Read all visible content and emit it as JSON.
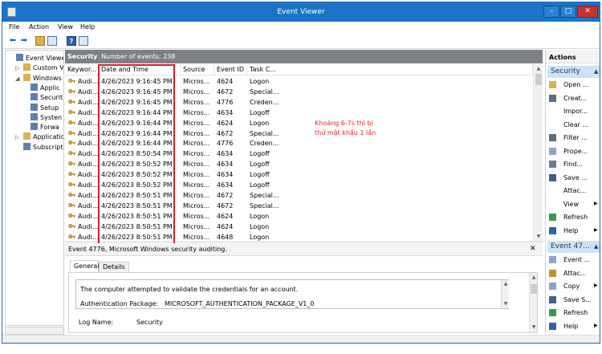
{
  "window": {
    "title": "Event Viewer",
    "minimize": "–",
    "maximize": "□",
    "close": "✕"
  },
  "menu": [
    "File",
    "Action",
    "View",
    "Help"
  ],
  "toolbar": {
    "back": "⬅",
    "forward": "➡",
    "help": "?"
  },
  "tree": [
    {
      "label": "Event Viewer (",
      "icon": "event-viewer-icon",
      "level": 0,
      "expander": ""
    },
    {
      "label": "Custom V",
      "icon": "folder-icon",
      "level": 1,
      "expander": "▷"
    },
    {
      "label": "Windows",
      "icon": "folder-icon",
      "level": 1,
      "expander": "◢"
    },
    {
      "label": "Applic",
      "icon": "log-icon",
      "level": 2,
      "expander": ""
    },
    {
      "label": "Securit",
      "icon": "log-icon",
      "level": 2,
      "expander": ""
    },
    {
      "label": "Setup",
      "icon": "log-icon",
      "level": 2,
      "expander": ""
    },
    {
      "label": "Systen",
      "icon": "log-icon",
      "level": 2,
      "expander": ""
    },
    {
      "label": "Forwa",
      "icon": "log-icon",
      "level": 2,
      "expander": ""
    },
    {
      "label": "Applicatio",
      "icon": "folder-icon",
      "level": 1,
      "expander": "▷"
    },
    {
      "label": "Subscripti",
      "icon": "subscription-icon",
      "level": 1,
      "expander": ""
    }
  ],
  "center": {
    "title": "Security",
    "count": "Number of events: 238"
  },
  "columns": [
    "Keywor...",
    "Date and Time",
    "Source",
    "Event ID",
    "Task C..."
  ],
  "rows": [
    {
      "k": "Audi...",
      "dt": "4/26/2023 9:16:45 PM",
      "src": "Micros...",
      "id": "4624",
      "task": "Logon"
    },
    {
      "k": "Audi...",
      "dt": "4/26/2023 9:16:45 PM",
      "src": "Micros...",
      "id": "4672",
      "task": "Special..."
    },
    {
      "k": "Audi...",
      "dt": "4/26/2023 9:16:45 PM",
      "src": "Micros...",
      "id": "4776",
      "task": "Creden..."
    },
    {
      "k": "Audi...",
      "dt": "4/26/2023 9:16:44 PM",
      "src": "Micros...",
      "id": "4634",
      "task": "Logoff"
    },
    {
      "k": "Audi...",
      "dt": "4/26/2023 9:16:44 PM",
      "src": "Micros...",
      "id": "4624",
      "task": "Logon"
    },
    {
      "k": "Audi...",
      "dt": "4/26/2023 9:16:44 PM",
      "src": "Micros...",
      "id": "4672",
      "task": "Special..."
    },
    {
      "k": "Audi...",
      "dt": "4/26/2023 9:16:44 PM",
      "src": "Micros...",
      "id": "4776",
      "task": "Creden..."
    },
    {
      "k": "Audi...",
      "dt": "4/26/2023 8:50:54 PM",
      "src": "Micros...",
      "id": "4634",
      "task": "Logoff"
    },
    {
      "k": "Audi...",
      "dt": "4/26/2023 8:50:52 PM",
      "src": "Micros...",
      "id": "4634",
      "task": "Logoff"
    },
    {
      "k": "Audi...",
      "dt": "4/26/2023 8:50:52 PM",
      "src": "Micros...",
      "id": "4634",
      "task": "Logoff"
    },
    {
      "k": "Audi...",
      "dt": "4/26/2023 8:50:52 PM",
      "src": "Micros...",
      "id": "4634",
      "task": "Logoff"
    },
    {
      "k": "Audi...",
      "dt": "4/26/2023 8:50:51 PM",
      "src": "Micros...",
      "id": "4672",
      "task": "Special..."
    },
    {
      "k": "Audi...",
      "dt": "4/26/2023 8:50:51 PM",
      "src": "Micros...",
      "id": "4672",
      "task": "Special..."
    },
    {
      "k": "Audi...",
      "dt": "4/26/2023 8:50:51 PM",
      "src": "Micros...",
      "id": "4624",
      "task": "Logon"
    },
    {
      "k": "Audi...",
      "dt": "4/26/2023 8:50:51 PM",
      "src": "Micros...",
      "id": "4624",
      "task": "Logon"
    },
    {
      "k": "Audi...",
      "dt": "4/26/2023 8:50:51 PM",
      "src": "Micros...",
      "id": "4648",
      "task": "Logon"
    }
  ],
  "annotation": {
    "line1": "Khoảng 6-7s thì bị",
    "line2": "thử mật khẩu 1 lần"
  },
  "detail": {
    "header": "Event 4776, Microsoft Windows security auditing.",
    "close": "✕",
    "tabs": [
      "General",
      "Details"
    ],
    "description": "The computer attempted to validate the credentials for an account.",
    "auth_label": "Authentication Package:",
    "auth_value": "MICROSOFT_AUTHENTICATION_PACKAGE_V1_0",
    "log_label": "Log Name:",
    "log_value": "Security"
  },
  "actions": {
    "title": "Actions",
    "section1": "Security",
    "section2": "Event 47...",
    "items1": [
      {
        "label": "Open ...",
        "icon": "open-log-icon",
        "arrow": ""
      },
      {
        "label": "Creat...",
        "icon": "filter-create-icon",
        "arrow": ""
      },
      {
        "label": "Impor...",
        "icon": "",
        "arrow": ""
      },
      {
        "label": "Clear ...",
        "icon": "",
        "arrow": ""
      },
      {
        "label": "Filter ...",
        "icon": "filter-icon",
        "arrow": ""
      },
      {
        "label": "Prope...",
        "icon": "properties-icon",
        "arrow": ""
      },
      {
        "label": "Find...",
        "icon": "find-icon",
        "arrow": ""
      },
      {
        "label": "Save ...",
        "icon": "save-icon",
        "arrow": ""
      },
      {
        "label": "Attac...",
        "icon": "",
        "arrow": ""
      },
      {
        "label": "View",
        "icon": "",
        "arrow": "▶"
      },
      {
        "label": "Refresh",
        "icon": "refresh-icon",
        "arrow": ""
      },
      {
        "label": "Help",
        "icon": "help-icon",
        "arrow": "▶"
      }
    ],
    "items2": [
      {
        "label": "Event ...",
        "icon": "event-properties-icon",
        "arrow": ""
      },
      {
        "label": "Attac...",
        "icon": "attach-task-icon",
        "arrow": ""
      },
      {
        "label": "Copy",
        "icon": "copy-icon",
        "arrow": "▶"
      },
      {
        "label": "Save S...",
        "icon": "save-icon",
        "arrow": ""
      },
      {
        "label": "Refresh",
        "icon": "refresh-icon",
        "arrow": ""
      },
      {
        "label": "Help",
        "icon": "help-icon",
        "arrow": "▶"
      }
    ]
  },
  "colors": {
    "titlebar": "#1b74c6",
    "accent": "#d0202a",
    "section": "#cfe1f3"
  }
}
